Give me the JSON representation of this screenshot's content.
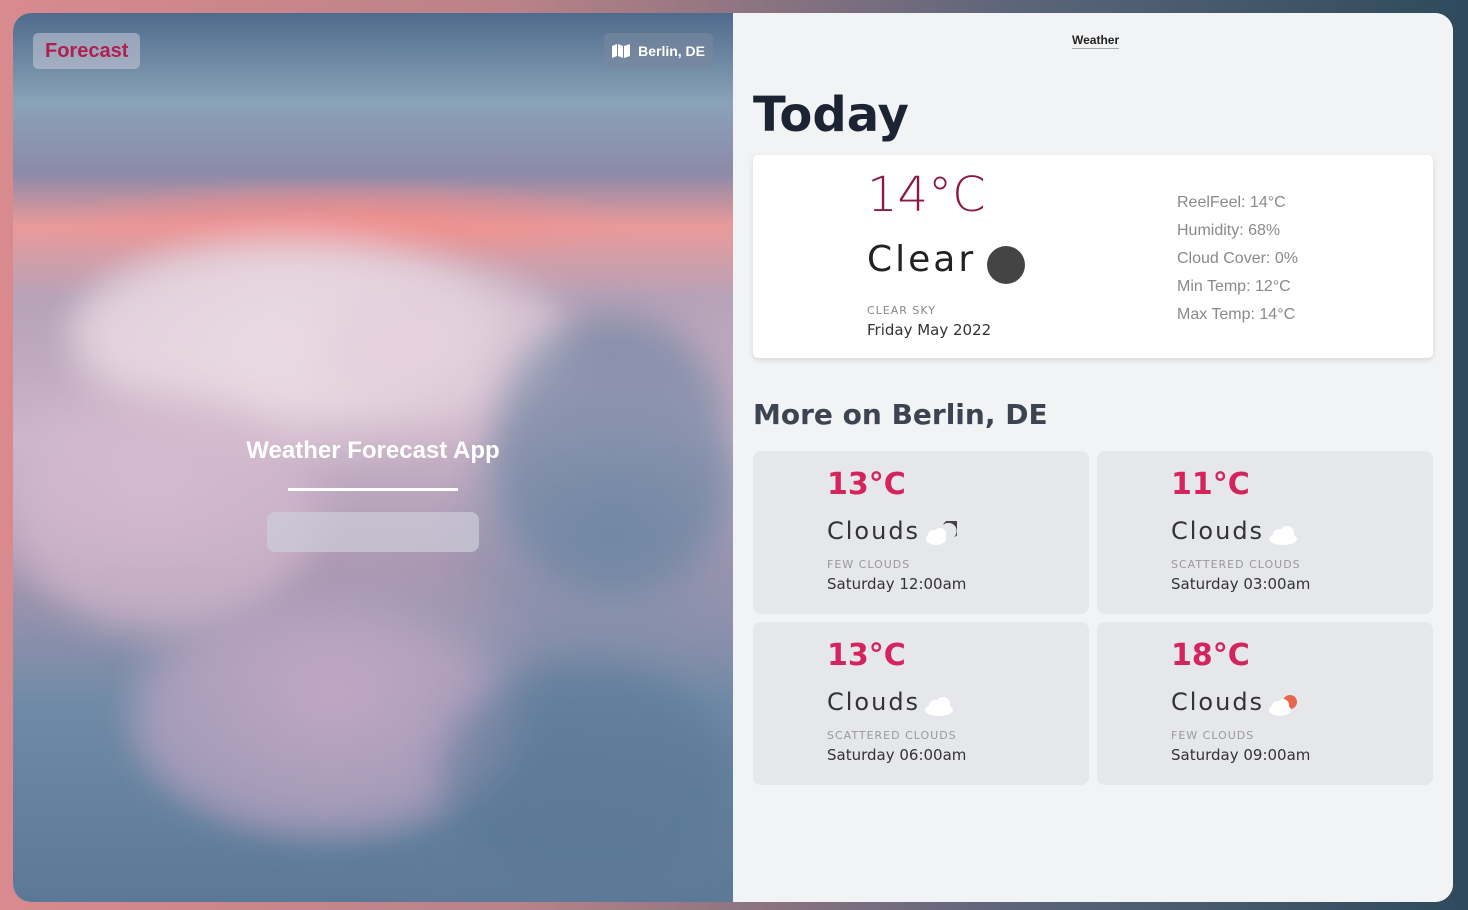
{
  "left": {
    "brand": "Forecast",
    "location_button": "Berlin, DE",
    "hero_title": "Weather Forecast App",
    "search": {
      "value": "",
      "placeholder": ""
    }
  },
  "right": {
    "nav_link": "Weather",
    "today": {
      "heading": "Today",
      "temp": "14°C",
      "condition": "Clear",
      "description": "CLEAR SKY",
      "date": "Friday May 2022",
      "stats": [
        "ReelFeel: 14°C",
        "Humidity: 68%",
        "Cloud Cover: 0%",
        "Min Temp: 12°C",
        "Max Temp: 14°C"
      ],
      "icon": "moon-icon"
    },
    "more": {
      "heading": "More on Berlin, DE",
      "cards": [
        {
          "temp": "13°C",
          "condition": "Clouds",
          "description": "FEW CLOUDS",
          "time": "Saturday 12:00am",
          "icon": "few-clouds-night-icon"
        },
        {
          "temp": "11°C",
          "condition": "Clouds",
          "description": "SCATTERED CLOUDS",
          "time": "Saturday 03:00am",
          "icon": "cloud-icon"
        },
        {
          "temp": "13°C",
          "condition": "Clouds",
          "description": "SCATTERED CLOUDS",
          "time": "Saturday 06:00am",
          "icon": "cloud-icon"
        },
        {
          "temp": "18°C",
          "condition": "Clouds",
          "description": "FEW CLOUDS",
          "time": "Saturday 09:00am",
          "icon": "few-clouds-day-icon"
        }
      ]
    }
  },
  "colors": {
    "brand": "#b0204f",
    "temp_today": "#8a1a45",
    "temp_card": "#d4245e"
  }
}
